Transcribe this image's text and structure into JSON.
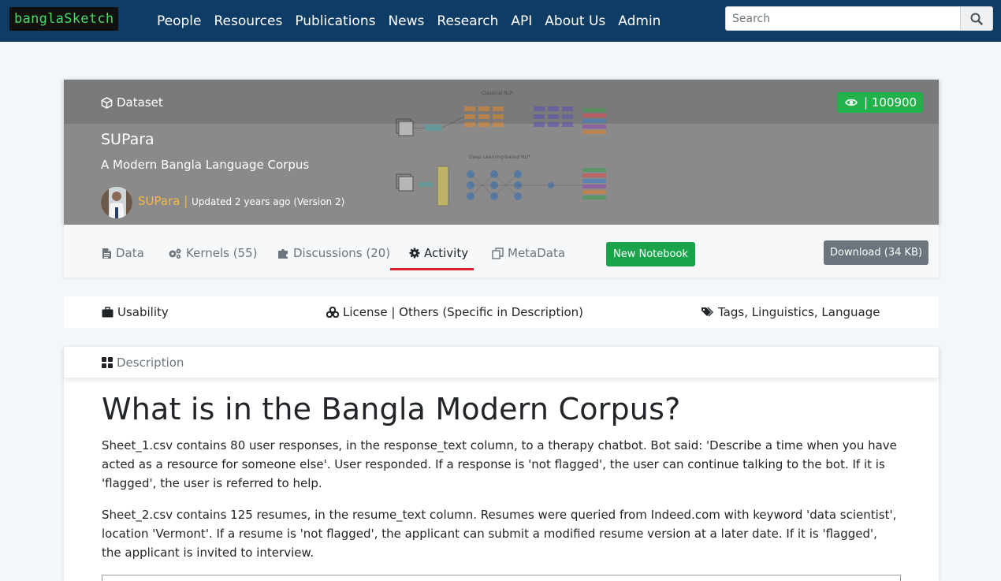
{
  "navbar": {
    "brand": "banglaSketch",
    "links": [
      "People",
      "Resources",
      "Publications",
      "News",
      "Research",
      "API",
      "About Us",
      "Admin"
    ],
    "search_placeholder": "Search"
  },
  "hero": {
    "type_label": "Dataset",
    "views": "| 100900",
    "title": "SUPara",
    "subtitle": "A Modern Bangla Language Corpus",
    "owner": "SUPara |",
    "meta": "Updated 2 years ago (Version 2)",
    "figure_labels": [
      "Classical NLP",
      "Deep Learning-based NLP"
    ]
  },
  "tabs": [
    {
      "label": "Data",
      "icon": "file-icon"
    },
    {
      "label": "Kernels (55)",
      "icon": "gears-icon"
    },
    {
      "label": "Discussions (20)",
      "icon": "puzzle-icon"
    },
    {
      "label": "Activity",
      "icon": "gear-icon",
      "active": true
    },
    {
      "label": "MetaData",
      "icon": "copy-icon"
    }
  ],
  "actions": {
    "new_notebook": "New Notebook",
    "download": "Download (34 KB)"
  },
  "info": {
    "usability": "Usability",
    "license": "License | Others (Specific in Description)",
    "tags": "Tags, Linguistics, Language"
  },
  "description": {
    "label": "Description",
    "heading": "What is in the Bangla Modern Corpus?",
    "paragraphs": [
      "Sheet_1.csv contains 80 user responses, in the response_text column, to a therapy chatbot. Bot said: 'Describe a time when you have acted as a resource for someone else'. User responded. If a response is 'not flagged', the user can continue talking to the bot. If it is 'flagged', the user is referred to help.",
      "Sheet_2.csv contains 125 resumes, in the resume_text column. Resumes were queried from Indeed.com with keyword 'data scientist', location 'Vermont'. If a resume is 'not flagged', the applicant can submit a modified resume version at a later date. If it is 'flagged', the applicant is invited to interview."
    ]
  },
  "colors": {
    "navbar": "#0f3c64",
    "brand_text": "#4cd964",
    "views_badge": "#22b24c",
    "owner": "#f5b942",
    "tab_underline": "#dc1f2d",
    "new_notebook": "#1aa34a",
    "download": "#6c757d"
  }
}
